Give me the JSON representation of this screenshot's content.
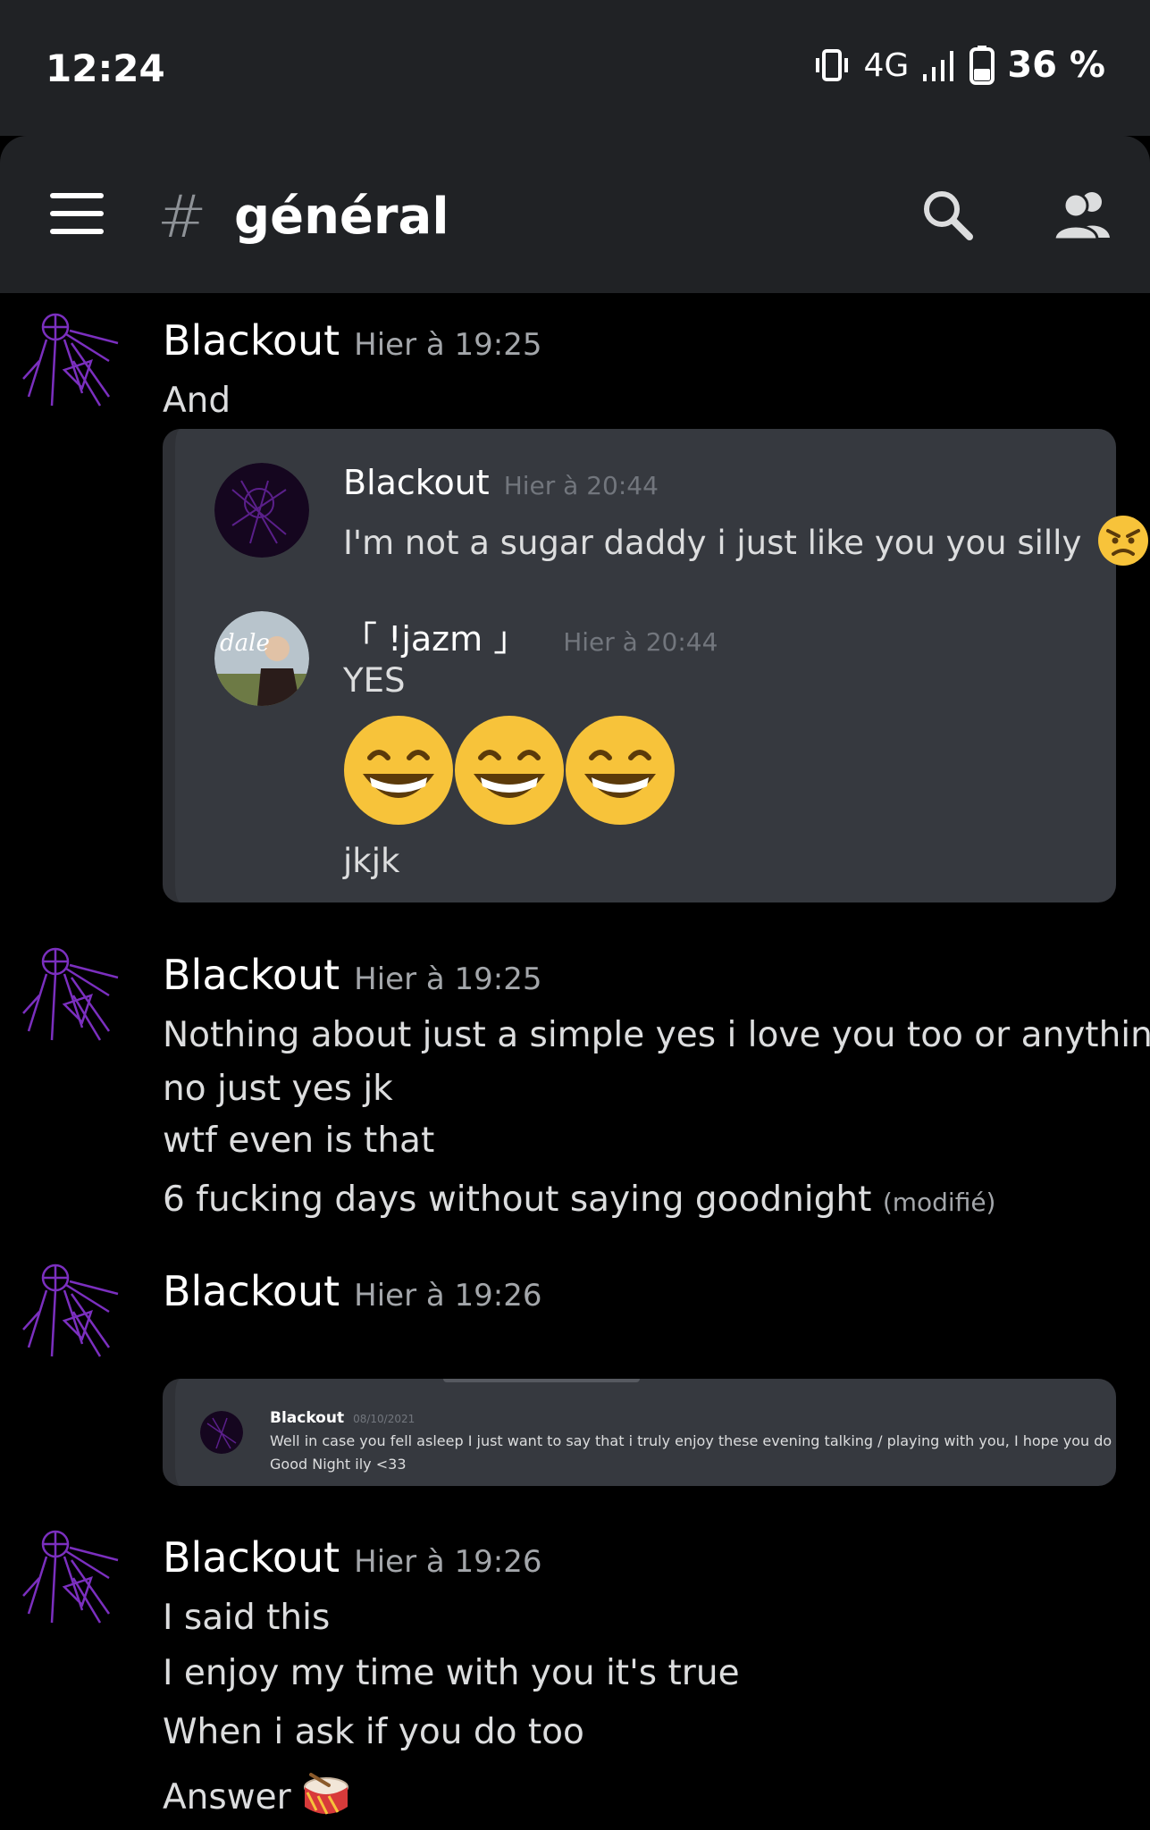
{
  "status_bar": {
    "time": "12:24",
    "network": "4G",
    "battery": "36 %"
  },
  "header": {
    "hash": "#",
    "channel": "général"
  },
  "messages": [
    {
      "author": "Blackout",
      "time": "Hier à 19:25",
      "lines": [
        "And"
      ],
      "embed": {
        "messages": [
          {
            "author": "Blackout",
            "time": "Hier à 20:44",
            "text": "I'm not a sugar daddy i just like you you silly"
          },
          {
            "author": "「 !jazm 」",
            "time": "Hier à 20:44",
            "text": "YES",
            "after": "jkjk"
          }
        ]
      }
    },
    {
      "author": "Blackout",
      "time": "Hier à 19:25",
      "lines": [
        "Nothing about just a simple yes i love you too or anything",
        "no just yes jk",
        "wtf even is that",
        "6 fucking days without saying goodnight"
      ],
      "edited": "(modifié)"
    },
    {
      "author": "Blackout",
      "time": "Hier à 19:26",
      "embed": {
        "author": "Blackout",
        "date": "08/10/2021",
        "lines": [
          "Well in case you fell asleep I just want to say that i truly enjoy these evening talking / playing with you, I hope you do too",
          "Good Night ily <33"
        ]
      }
    },
    {
      "author": "Blackout",
      "time": "Hier à 19:26",
      "lines": [
        "I said this",
        "I enjoy my time with you it's true",
        "When i ask if you do too",
        "Answer"
      ]
    }
  ],
  "colors": {
    "background": "#000000",
    "header_bg": "#202225",
    "embed_bg": "#36393f",
    "avatar_purple": "#7b2fbf",
    "emoji_yellow": "#f7c33a"
  },
  "icons": [
    "hamburger-menu-icon",
    "search-icon",
    "members-icon",
    "vibrate-icon",
    "signal-icon",
    "battery-icon",
    "angry-face-emoji",
    "grinning-face-emoji",
    "drum-emoji"
  ]
}
